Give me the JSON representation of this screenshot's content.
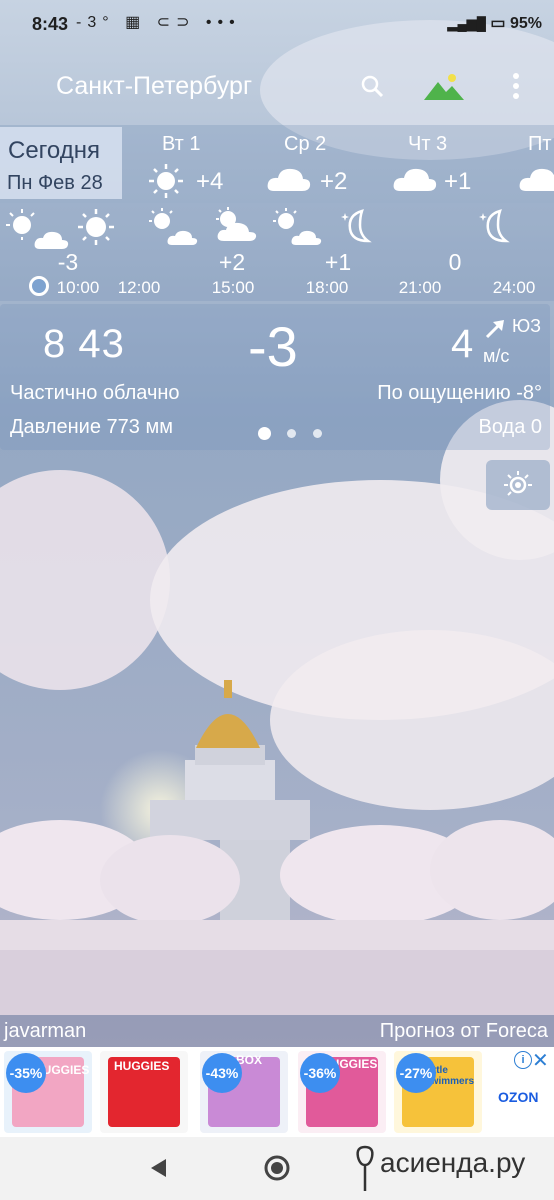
{
  "status_bar": {
    "time": "8:43",
    "temp": "-3°",
    "battery": "95%"
  },
  "header": {
    "city": "Санкт-Петербург"
  },
  "days": {
    "today": {
      "label": "Сегодня",
      "date": "Пн Фев 28"
    },
    "list": [
      {
        "name": "Вт 1",
        "temp": "+4",
        "icon": "sun-icon"
      },
      {
        "name": "Ср 2",
        "temp": "+2",
        "icon": "cloud-icon"
      },
      {
        "name": "Чт 3",
        "temp": "+1",
        "icon": "cloud-icon"
      },
      {
        "name": "Пт",
        "temp": "",
        "icon": "cloud-icon"
      }
    ]
  },
  "hourly": {
    "temps": [
      "-3",
      "+2",
      "+1",
      "0"
    ],
    "times": [
      "10:00",
      "12:00",
      "15:00",
      "18:00",
      "21:00",
      "24:00"
    ]
  },
  "current": {
    "time": "8 43",
    "temp": "-3",
    "wind_speed": "4",
    "wind_dir": "ЮЗ",
    "wind_unit": "м/с",
    "condition": "Частично облачно",
    "feels_like": "По ощущению -8°",
    "pressure": "Давление 773 мм",
    "water": "Вода 0"
  },
  "credits": {
    "author": "javarman",
    "provider": "Прогноз от Foreca"
  },
  "ad": {
    "badges": [
      "-35%",
      "-43%",
      "-36%",
      "-27%"
    ],
    "brands": [
      "HUGGIES",
      "HUGGIES",
      "BOX",
      "HUGGIES",
      "Little Swimmers"
    ],
    "merchant": "OZON"
  },
  "watermark": "асиенда.ру",
  "colors": {
    "accent": "#3d8ef0",
    "sky": "#8ea3bd"
  }
}
